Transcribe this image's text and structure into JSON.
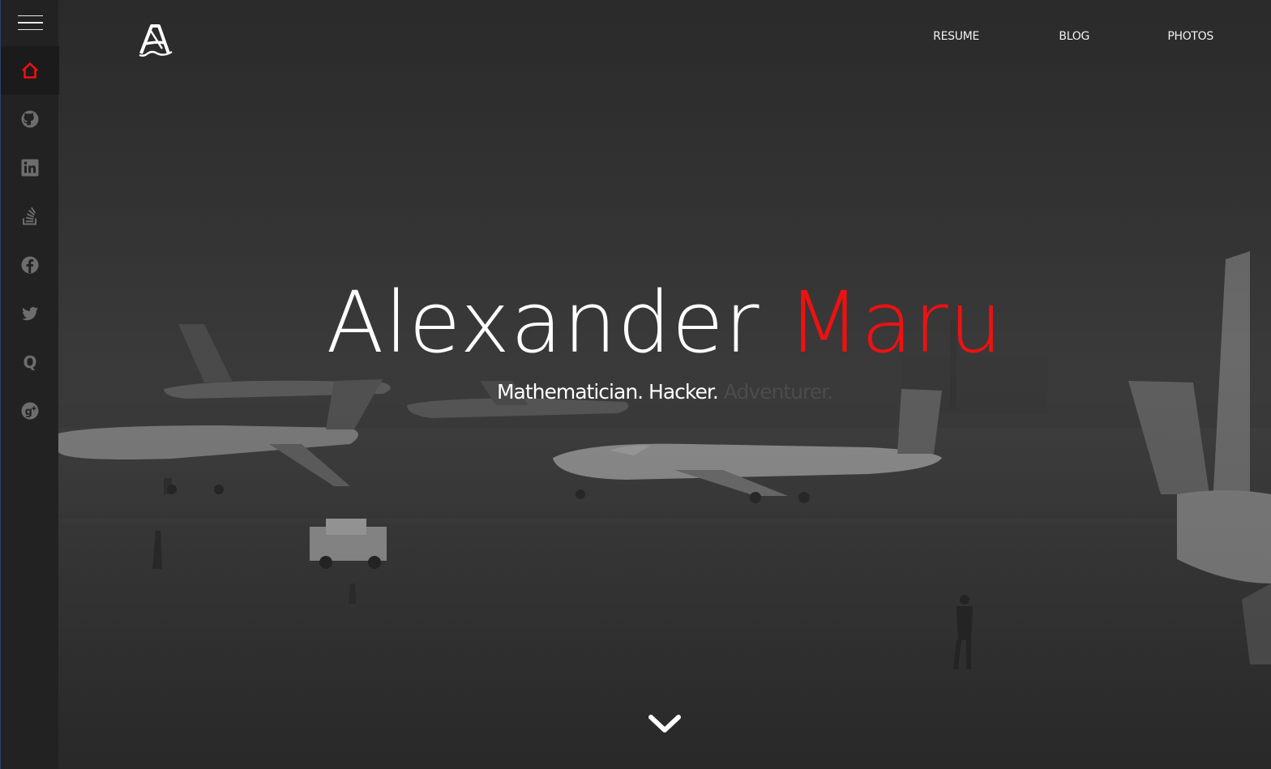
{
  "sidebar": {
    "menu_label": "menu",
    "items": [
      {
        "icon": "home-icon",
        "active": true
      },
      {
        "icon": "github-icon",
        "active": false
      },
      {
        "icon": "linkedin-icon",
        "active": false
      },
      {
        "icon": "stackoverflow-icon",
        "active": false
      },
      {
        "icon": "facebook-icon",
        "active": false
      },
      {
        "icon": "twitter-icon",
        "active": false
      },
      {
        "icon": "quora-icon",
        "active": false
      },
      {
        "icon": "google-plus-icon",
        "active": false
      }
    ]
  },
  "header": {
    "logo_icon": "logo-a-icon",
    "nav": {
      "resume": "RESUME",
      "blog": "BLOG",
      "photos": "PHOTOS"
    }
  },
  "hero": {
    "first_name": "Alexander",
    "last_name": "Maru",
    "tagline_bright": "Mathematician. Hacker.",
    "tagline_dim": "Adventurer.",
    "scroll_icon": "chevron-down-icon"
  },
  "colors": {
    "accent": "#ee1111",
    "sidebar_bg": "#222223",
    "text_primary": "#ffffff",
    "icon_muted": "#6d6d6d"
  }
}
